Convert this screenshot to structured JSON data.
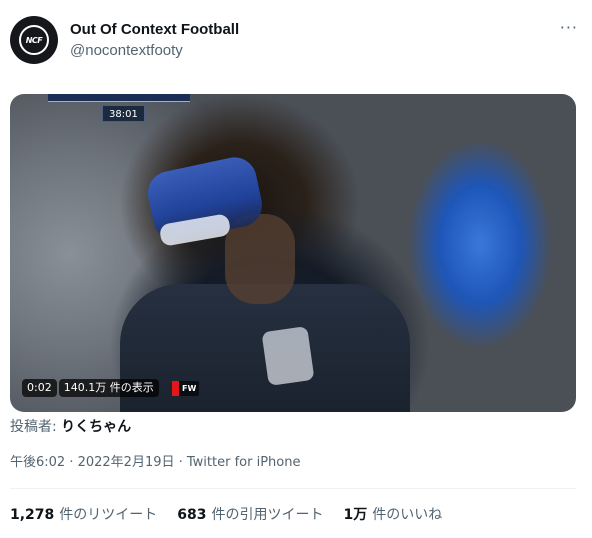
{
  "tweet": {
    "author": {
      "display_name": "Out Of Context Football",
      "handle": "@nocontextfooty",
      "avatar_text": "NCF"
    },
    "more_label": "···",
    "media": {
      "score_clock": "38:01",
      "elapsed": "0:02",
      "views": "140.1万 件の表示",
      "badge": "FW"
    },
    "poster": {
      "label": "投稿者: ",
      "name": "りくちゃん"
    },
    "timestamp": "午後6:02 · 2022年2月19日 · Twitter for iPhone",
    "stats": [
      {
        "count": "1,278",
        "label": "件のリツイート"
      },
      {
        "count": "683",
        "label": "件の引用ツイート"
      },
      {
        "count": "1万",
        "label": "件のいいね"
      }
    ]
  },
  "colors": {
    "text_primary": "#0f1419",
    "text_secondary": "#536471",
    "divider": "#eff3f4"
  }
}
